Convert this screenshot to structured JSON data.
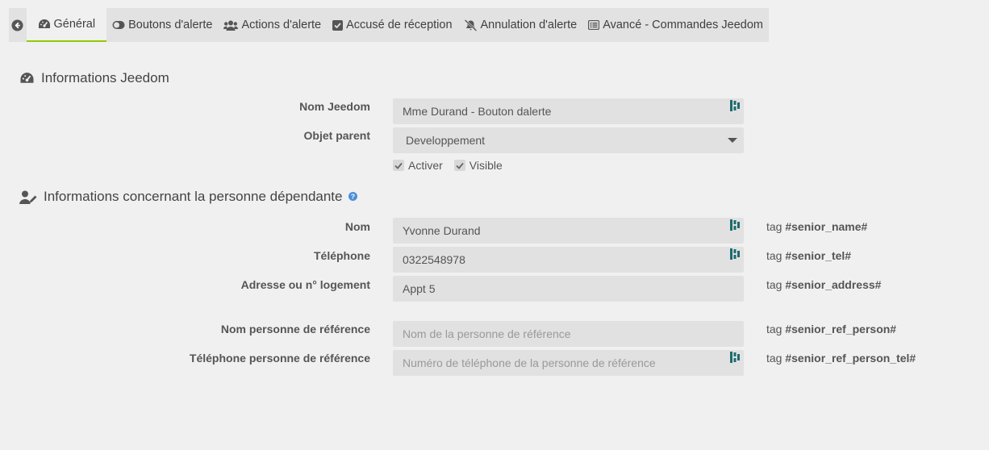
{
  "tabs": [
    {
      "label": "Général",
      "icon": "tachometer-icon"
    },
    {
      "label": "Boutons d'alerte",
      "icon": "toggle-icon"
    },
    {
      "label": "Actions d'alerte",
      "icon": "users-icon"
    },
    {
      "label": "Accusé de réception",
      "icon": "check-square-icon"
    },
    {
      "label": "Annulation d'alerte",
      "icon": "bell-slash-icon"
    },
    {
      "label": "Avancé - Commandes Jeedom",
      "icon": "list-alt-icon"
    }
  ],
  "section_jeedom": {
    "title": "Informations Jeedom",
    "name_label": "Nom Jeedom",
    "name_value": "Mme Durand - Bouton dalerte",
    "parent_label": "Objet parent",
    "parent_value": "Developpement",
    "activate_label": "Activer",
    "visible_label": "Visible"
  },
  "section_person": {
    "title": "Informations concernant la personne dépendante",
    "help_glyph": "?",
    "fields": [
      {
        "label": "Nom",
        "value": "Yvonne Durand",
        "placeholder": "",
        "tag_prefix": "tag",
        "tag": "#senior_name#"
      },
      {
        "label": "Téléphone",
        "value": "0322548978",
        "placeholder": "",
        "tag_prefix": "tag",
        "tag": "#senior_tel#"
      },
      {
        "label": "Adresse ou n° logement",
        "value": "Appt 5",
        "placeholder": "",
        "tag_prefix": "tag",
        "tag": "#senior_address#"
      },
      {
        "label": "Nom personne de référence",
        "value": "",
        "placeholder": "Nom de la personne de référence",
        "tag_prefix": "tag",
        "tag": "#senior_ref_person#"
      },
      {
        "label": "Téléphone personne de référence",
        "value": "",
        "placeholder": "Numéro de téléphone de la personne de référence",
        "tag_prefix": "tag",
        "tag": "#senior_ref_person_tel#"
      }
    ]
  },
  "colors": {
    "active_tab_underline": "#94ca02",
    "field_bg": "#e1e1e1",
    "badge": "#1d6b6e",
    "help": "#4a8fd8"
  }
}
